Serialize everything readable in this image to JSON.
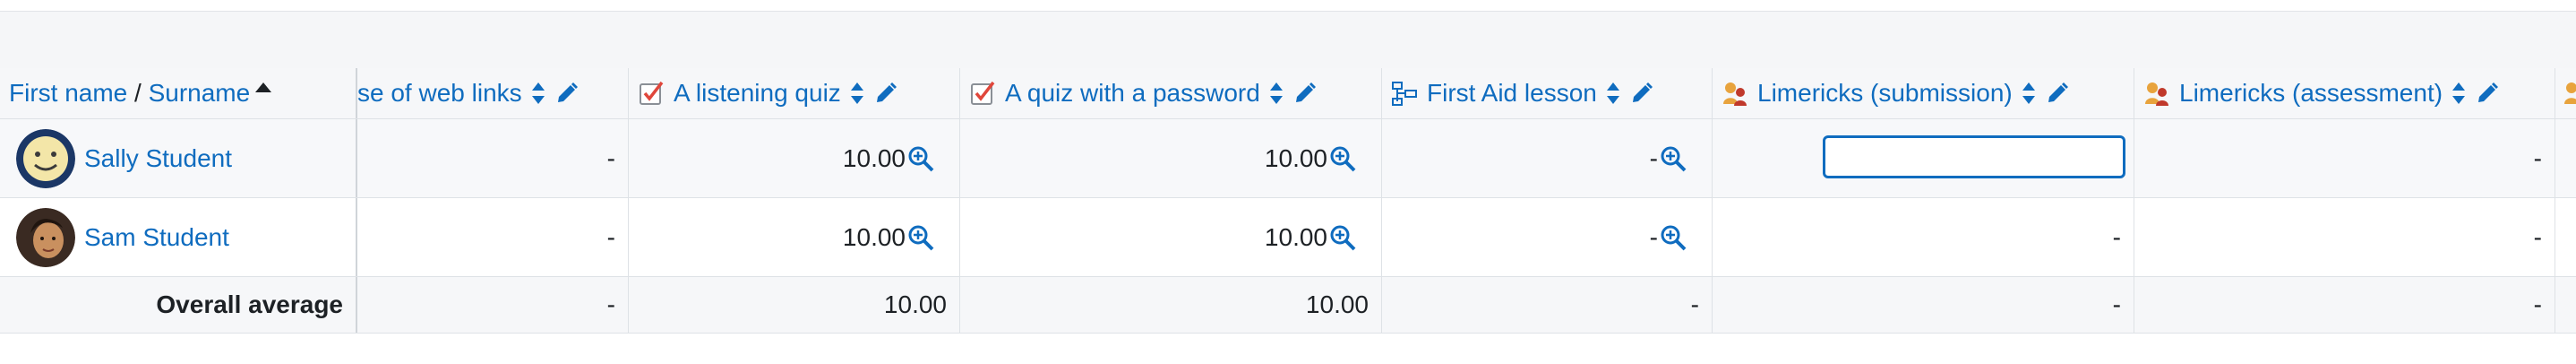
{
  "header": {
    "name_col": {
      "first": "First name",
      "sep": " / ",
      "last": "Surname"
    },
    "columns": [
      {
        "label": "se of web links",
        "icon": "link-icon"
      },
      {
        "label": "A listening quiz",
        "icon": "quiz-icon"
      },
      {
        "label": "A quiz with a password",
        "icon": "quiz-icon"
      },
      {
        "label": "First Aid lesson",
        "icon": "lesson-icon"
      },
      {
        "label": "Limericks (submission)",
        "icon": "workshop-icon"
      },
      {
        "label": "Limericks (assessment)",
        "icon": "workshop-icon"
      }
    ]
  },
  "rows": [
    {
      "name": "Sally Student",
      "grades": [
        "-",
        "10.00",
        "10.00",
        "-",
        "",
        "-"
      ]
    },
    {
      "name": "Sam Student",
      "grades": [
        "-",
        "10.00",
        "10.00",
        "-",
        "-",
        "-"
      ]
    }
  ],
  "overall": {
    "label": "Overall average",
    "values": [
      "-",
      "10.00",
      "10.00",
      "-",
      "-",
      "-"
    ]
  },
  "colors": {
    "link": "#0f6cbf",
    "input_border": "#0f6cbf"
  }
}
